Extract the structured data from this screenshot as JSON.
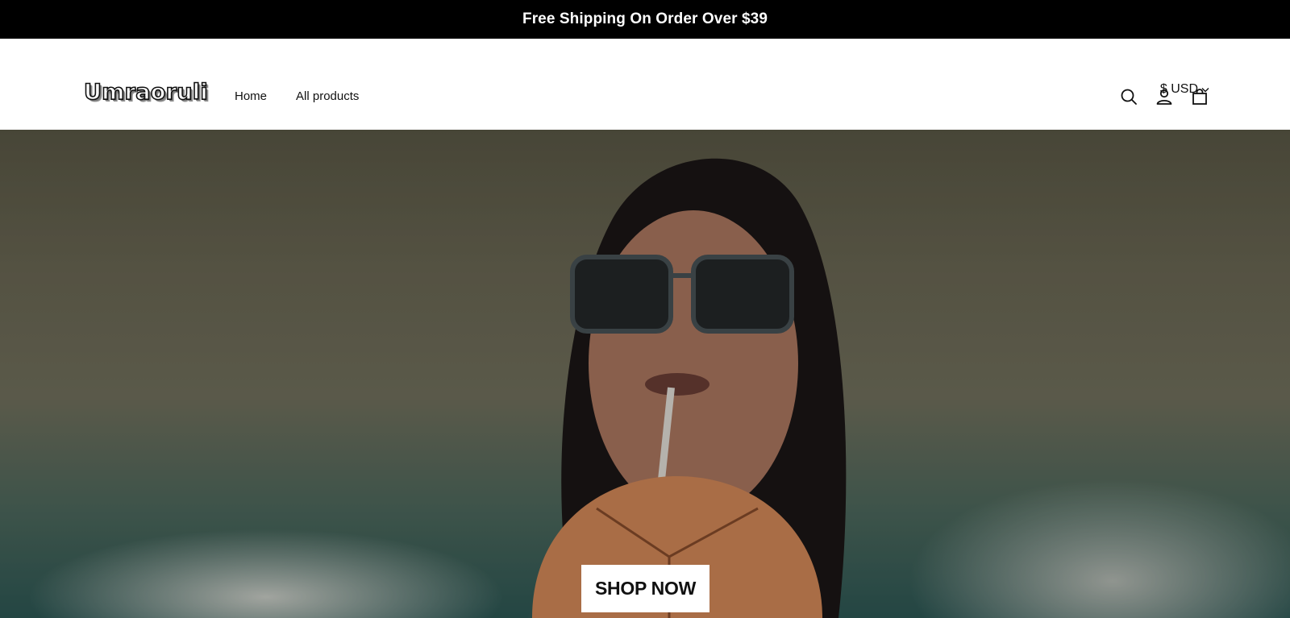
{
  "announcement": {
    "text": "Free Shipping On Order Over $39"
  },
  "header": {
    "currency": {
      "label": "$ USD"
    },
    "logo": {
      "text": "Umraoruli"
    },
    "nav": [
      {
        "label": "Home"
      },
      {
        "label": "All products"
      }
    ],
    "icons": [
      "search-icon",
      "account-icon",
      "cart-icon"
    ]
  },
  "hero": {
    "cta_label": "SHOP NOW",
    "colors": {
      "cta_bg": "#ffffff",
      "cta_text": "#111111",
      "bar_bg": "#000000"
    }
  }
}
